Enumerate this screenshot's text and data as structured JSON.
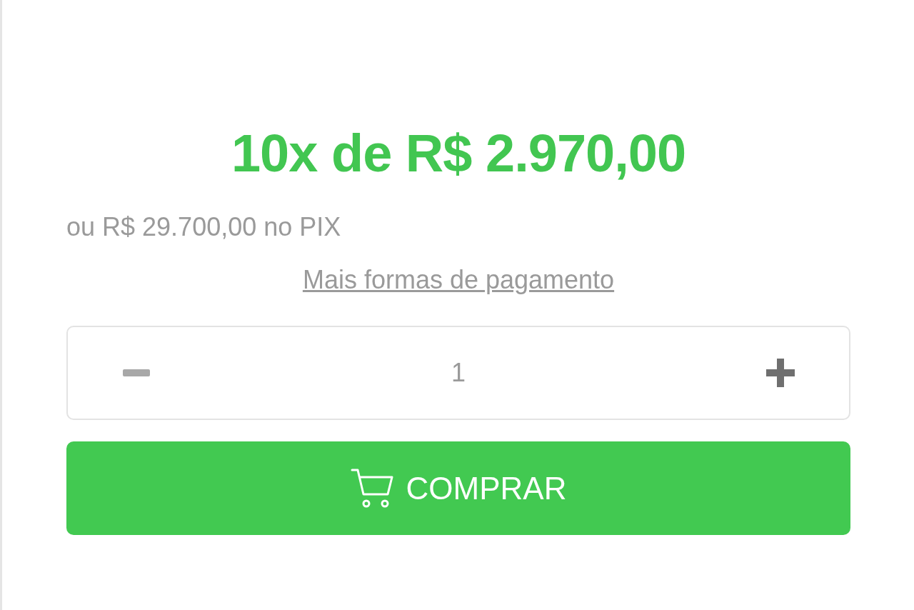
{
  "price": {
    "installment": "10x de R$ 2.970,00",
    "pix": "ou R$ 29.700,00 no PIX",
    "more_link": "Mais formas de pagamento"
  },
  "quantity": {
    "value": "1",
    "decrease_disabled": true,
    "increase_disabled": false
  },
  "buy_button": {
    "label": "COMPRAR"
  }
}
